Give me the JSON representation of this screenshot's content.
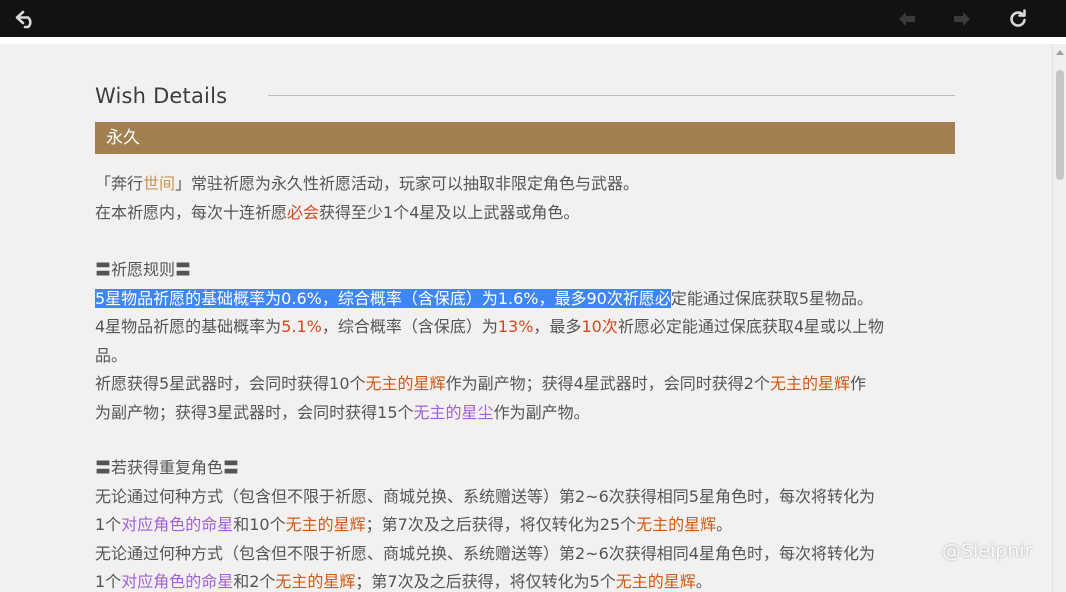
{
  "toolbar": {
    "back_icon": "back-arrow-icon",
    "prev_icon": "prev-icon",
    "next_icon": "next-icon",
    "refresh_icon": "refresh-icon"
  },
  "page": {
    "title": "Wish Details",
    "banner": "永久"
  },
  "intro": {
    "l1_a": "「奔行",
    "l1_b": "世间",
    "l1_c": "」常驻祈愿为永久性祈愿活动，玩家可以抽取非限定角色与武器。",
    "l2_a": "在本祈愿内，每次十连祈愿",
    "l2_b": "必会",
    "l2_c": "获得至少1个4星及以上武器或角色。"
  },
  "rules": {
    "heading": "〓祈愿规则〓",
    "l1_sel": "5星物品祈愿的基础概率为0.6%，综合概率（含保底）为1.6%，最多90次祈愿必",
    "l1_rest": "定能通过保底获取5星物品。",
    "l2_a": "4星物品祈愿的基础概率为",
    "l2_b": "5.1%",
    "l2_c": "，综合概率（含保底）为",
    "l2_d": "13%",
    "l2_e": "，最多",
    "l2_f": "10次",
    "l2_g": "祈愿必定能通过保底获取4星或以上物",
    "l3": "品。",
    "l4_a": "祈愿获得5星武器时，会同时获得10个",
    "l4_b": "无主的星辉",
    "l4_c": "作为副产物；获得4星武器时，会同时获得2个",
    "l4_d": "无主的星辉",
    "l4_e": "作",
    "l5_a": "为副产物；获得3星武器时，会同时获得15个",
    "l5_b": "无主的星尘",
    "l5_c": "作为副产物。"
  },
  "duplicates": {
    "heading": "〓若获得重复角色〓",
    "l1": "无论通过何种方式（包含但不限于祈愿、商城兑换、系统赠送等）第2~6次获得相同5星角色时，每次将转化为",
    "l2_a": "1个",
    "l2_b": "对应角色的命星",
    "l2_c": "和10个",
    "l2_d": "无主的星辉",
    "l2_e": "；第7次及之后获得，将仅转化为25个",
    "l2_f": "无主的星辉",
    "l2_g": "。",
    "l3": "无论通过何种方式（包含但不限于祈愿、商城兑换、系统赠送等）第2~6次获得相同4星角色时，每次将转化为",
    "l4_a": "1个",
    "l4_b": "对应角色的命星",
    "l4_c": "和2个",
    "l4_d": "无主的星辉",
    "l4_e": "；第7次及之后获得，将仅转化为5个",
    "l4_f": "无主的星辉",
    "l4_g": "。"
  },
  "watermark": "@Sleipnir",
  "colors": {
    "toolbar_bg": "#121212",
    "page_bg": "#f3f1ef",
    "banner_bg": "#a17f50",
    "highlight_red": "#d14a1f",
    "highlight_orange": "#d05a16",
    "highlight_purple": "#a160dc",
    "highlight_gold": "#c8935a",
    "selection": "#3f86f5"
  }
}
